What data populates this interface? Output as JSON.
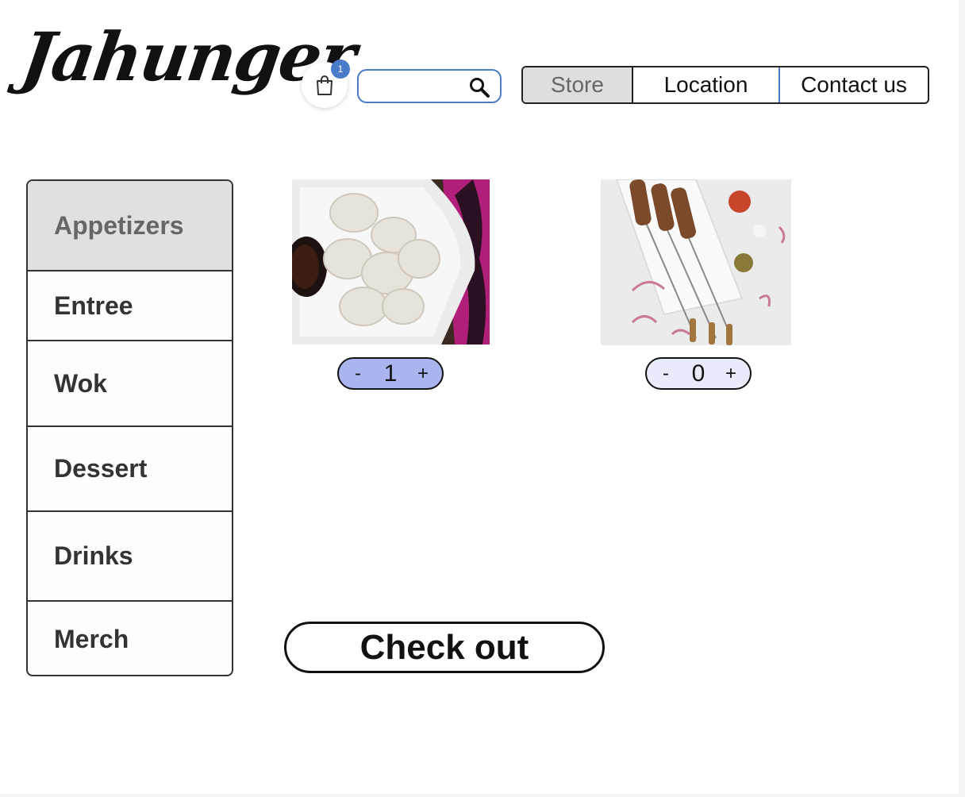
{
  "brand": {
    "logo_text": "Jahunger"
  },
  "cart": {
    "badge_count": "1",
    "icon": "shopping-bag-icon"
  },
  "search": {
    "placeholder": "",
    "value": "",
    "icon": "search-icon"
  },
  "nav": {
    "tabs": [
      {
        "label": "Store",
        "active": true
      },
      {
        "label": "Location",
        "active": false
      },
      {
        "label": "Contact us",
        "active": false
      }
    ]
  },
  "sidebar": {
    "items": [
      {
        "label": "Appetizers",
        "active": true
      },
      {
        "label": "Entree",
        "active": false
      },
      {
        "label": "Wok",
        "active": false
      },
      {
        "label": "Dessert",
        "active": false
      },
      {
        "label": "Drinks",
        "active": false
      },
      {
        "label": "Merch",
        "active": false
      }
    ]
  },
  "products": [
    {
      "image": "dumplings-photo",
      "minus": "-",
      "quantity": "1",
      "plus": "+",
      "stepper_color": "#aab5f0"
    },
    {
      "image": "skewers-photo",
      "minus": "-",
      "quantity": "0",
      "plus": "+",
      "stepper_color": "#e8ebfa"
    }
  ],
  "checkout": {
    "label": "Check out"
  },
  "colors": {
    "accent": "#4a7bc8",
    "active_tab": "#dedede"
  }
}
